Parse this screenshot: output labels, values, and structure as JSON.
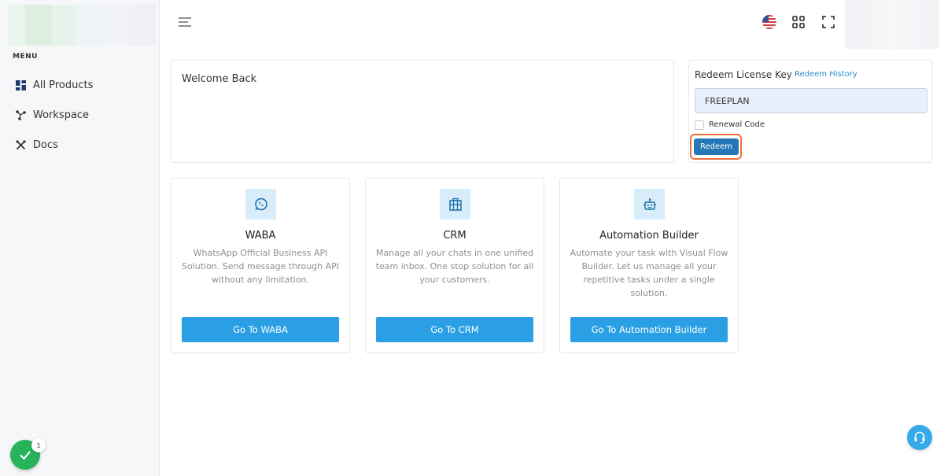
{
  "sidebar": {
    "menu_title": "MENU",
    "items": [
      {
        "label": "All Products",
        "icon": "dashboard-icon"
      },
      {
        "label": "Workspace",
        "icon": "workspace-icon"
      },
      {
        "label": "Docs",
        "icon": "tools-icon"
      }
    ],
    "status_badge_count": "1"
  },
  "header": {
    "language_flag": "us-flag-icon"
  },
  "welcome": {
    "title": "Welcome Back"
  },
  "redeem": {
    "title": "Redeem License Key",
    "history_link": "Redeem History",
    "input_value": "FREEPLAN",
    "renewal_label": "Renewal Code",
    "renewal_checked": false,
    "button_label": "Redeem"
  },
  "products": [
    {
      "name": "WABA",
      "description": "WhatsApp Official Business API Solution. Send message through API without any limitation.",
      "button": "Go To WABA",
      "icon": "whatsapp-icon"
    },
    {
      "name": "CRM",
      "description": "Manage all your chats in one unified team inbox. One stop solution for all your customers.",
      "button": "Go To CRM",
      "icon": "building-icon"
    },
    {
      "name": "Automation Builder",
      "description": "Automate your task with Visual Flow Builder. Let us manage all your repetitive tasks under a single solution.",
      "button": "Go To Automation Builder",
      "icon": "robot-icon"
    }
  ],
  "colors": {
    "accent": "#2b9fe3",
    "redeem_button": "#2677b5",
    "focus_ring": "#f06d3a",
    "success": "#27b35a"
  }
}
